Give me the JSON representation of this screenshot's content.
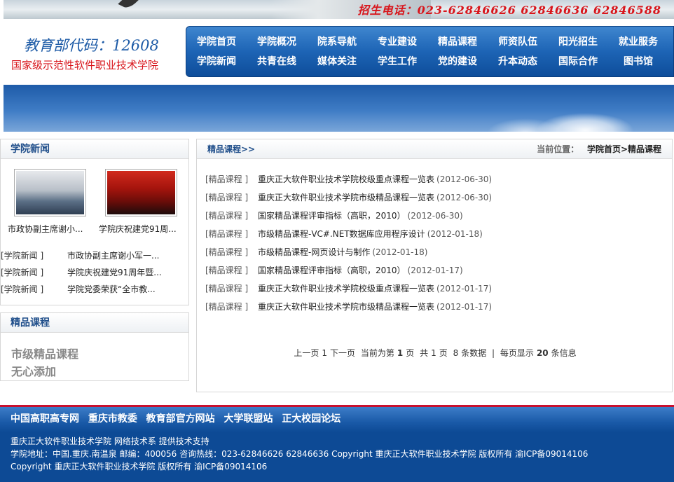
{
  "header": {
    "hotline": "招生电话：023-62846626  62846636  62846588",
    "ministry_code": "教育部代码：12608",
    "tagline": "国家级示范性软件职业技术学院"
  },
  "nav": {
    "row1": [
      "学院首页",
      "学院概况",
      "院系导航",
      "专业建设",
      "精品课程",
      "师资队伍",
      "阳光招生",
      "就业服务"
    ],
    "row2": [
      "学院新闻",
      "共青在线",
      "媒体关注",
      "学生工作",
      "党的建设",
      "升本动态",
      "国际合作",
      "图书馆"
    ]
  },
  "news_panel": {
    "title": "学院新闻",
    "thumbs": [
      {
        "caption": "市政协副主席谢小..."
      },
      {
        "caption": "学院庆祝建党91周..."
      }
    ],
    "items": [
      {
        "cat": "[学院新闻 ]",
        "title": "市政协副主席谢小军一..."
      },
      {
        "cat": "[学院新闻 ]",
        "title": "学院庆祝建党91周年暨..."
      },
      {
        "cat": "[学院新闻 ]",
        "title": "学院党委荣获“全市教..."
      }
    ]
  },
  "course_panel": {
    "title": "精品课程",
    "items": [
      "市级精品课程",
      "无心添加"
    ]
  },
  "content": {
    "title": "精品课程>>",
    "crumb_label": "当前位置：",
    "crumb_path": "学院首页>精品课程",
    "items": [
      {
        "cat": "[精品课程 ]",
        "title": "重庆正大软件职业技术学院校级重点课程一览表",
        "date": "(2012-06-30)"
      },
      {
        "cat": "[精品课程 ]",
        "title": "重庆正大软件职业技术学院市级精品课程一览表",
        "date": "(2012-06-30)"
      },
      {
        "cat": "[精品课程 ]",
        "title": "国家精品课程评审指标（高职，2010）",
        "date": "(2012-06-30)"
      },
      {
        "cat": "[精品课程 ]",
        "title": "市级精品课程-VC#.NET数据库应用程序设计",
        "date": "(2012-01-18)"
      },
      {
        "cat": "[精品课程 ]",
        "title": "市级精品课程-网页设计与制作",
        "date": "(2012-01-18)"
      },
      {
        "cat": "[精品课程 ]",
        "title": "国家精品课程评审指标（高职，2010）",
        "date": "(2012-01-17)"
      },
      {
        "cat": "[精品课程 ]",
        "title": "重庆正大软件职业技术学院校级重点课程一览表",
        "date": "(2012-01-17)"
      },
      {
        "cat": "[精品课程 ]",
        "title": "重庆正大软件职业技术学院市级精品课程一览表",
        "date": "(2012-01-17)"
      }
    ],
    "pager": {
      "prev": "上一页",
      "current_page": "1",
      "next": "下一页",
      "now_at": "当前为第",
      "page_unit": "页",
      "total_prefix": "共",
      "total_pages": "1",
      "total_unit": "页",
      "records": "8",
      "records_unit": "条数据",
      "sep": "|",
      "per_page_label": "每页显示",
      "per_page": "20",
      "per_page_unit": "条信息"
    }
  },
  "footer": {
    "links": [
      "中国高职高专网",
      "重庆市教委",
      "教育部官方网站",
      "大学联盟站",
      "正大校园论坛"
    ],
    "line1": "重庆正大软件职业技术学院 网络技术系 提供技术支持",
    "line2": "学院地址：中国.重庆.南温泉 邮编：400056 咨询热线：023-62846626 62846636 Copyright 重庆正大软件职业技术学院 版权所有 渝ICP备09014106",
    "line3": "Copyright 重庆正大软件职业技术学院 版权所有 渝ICP备09014106"
  },
  "colors": {
    "nav_blue": "#1d64b5",
    "accent_red": "#d8151b",
    "heading_blue": "#1f4e8a",
    "footer_blue": "#0d4a95"
  }
}
